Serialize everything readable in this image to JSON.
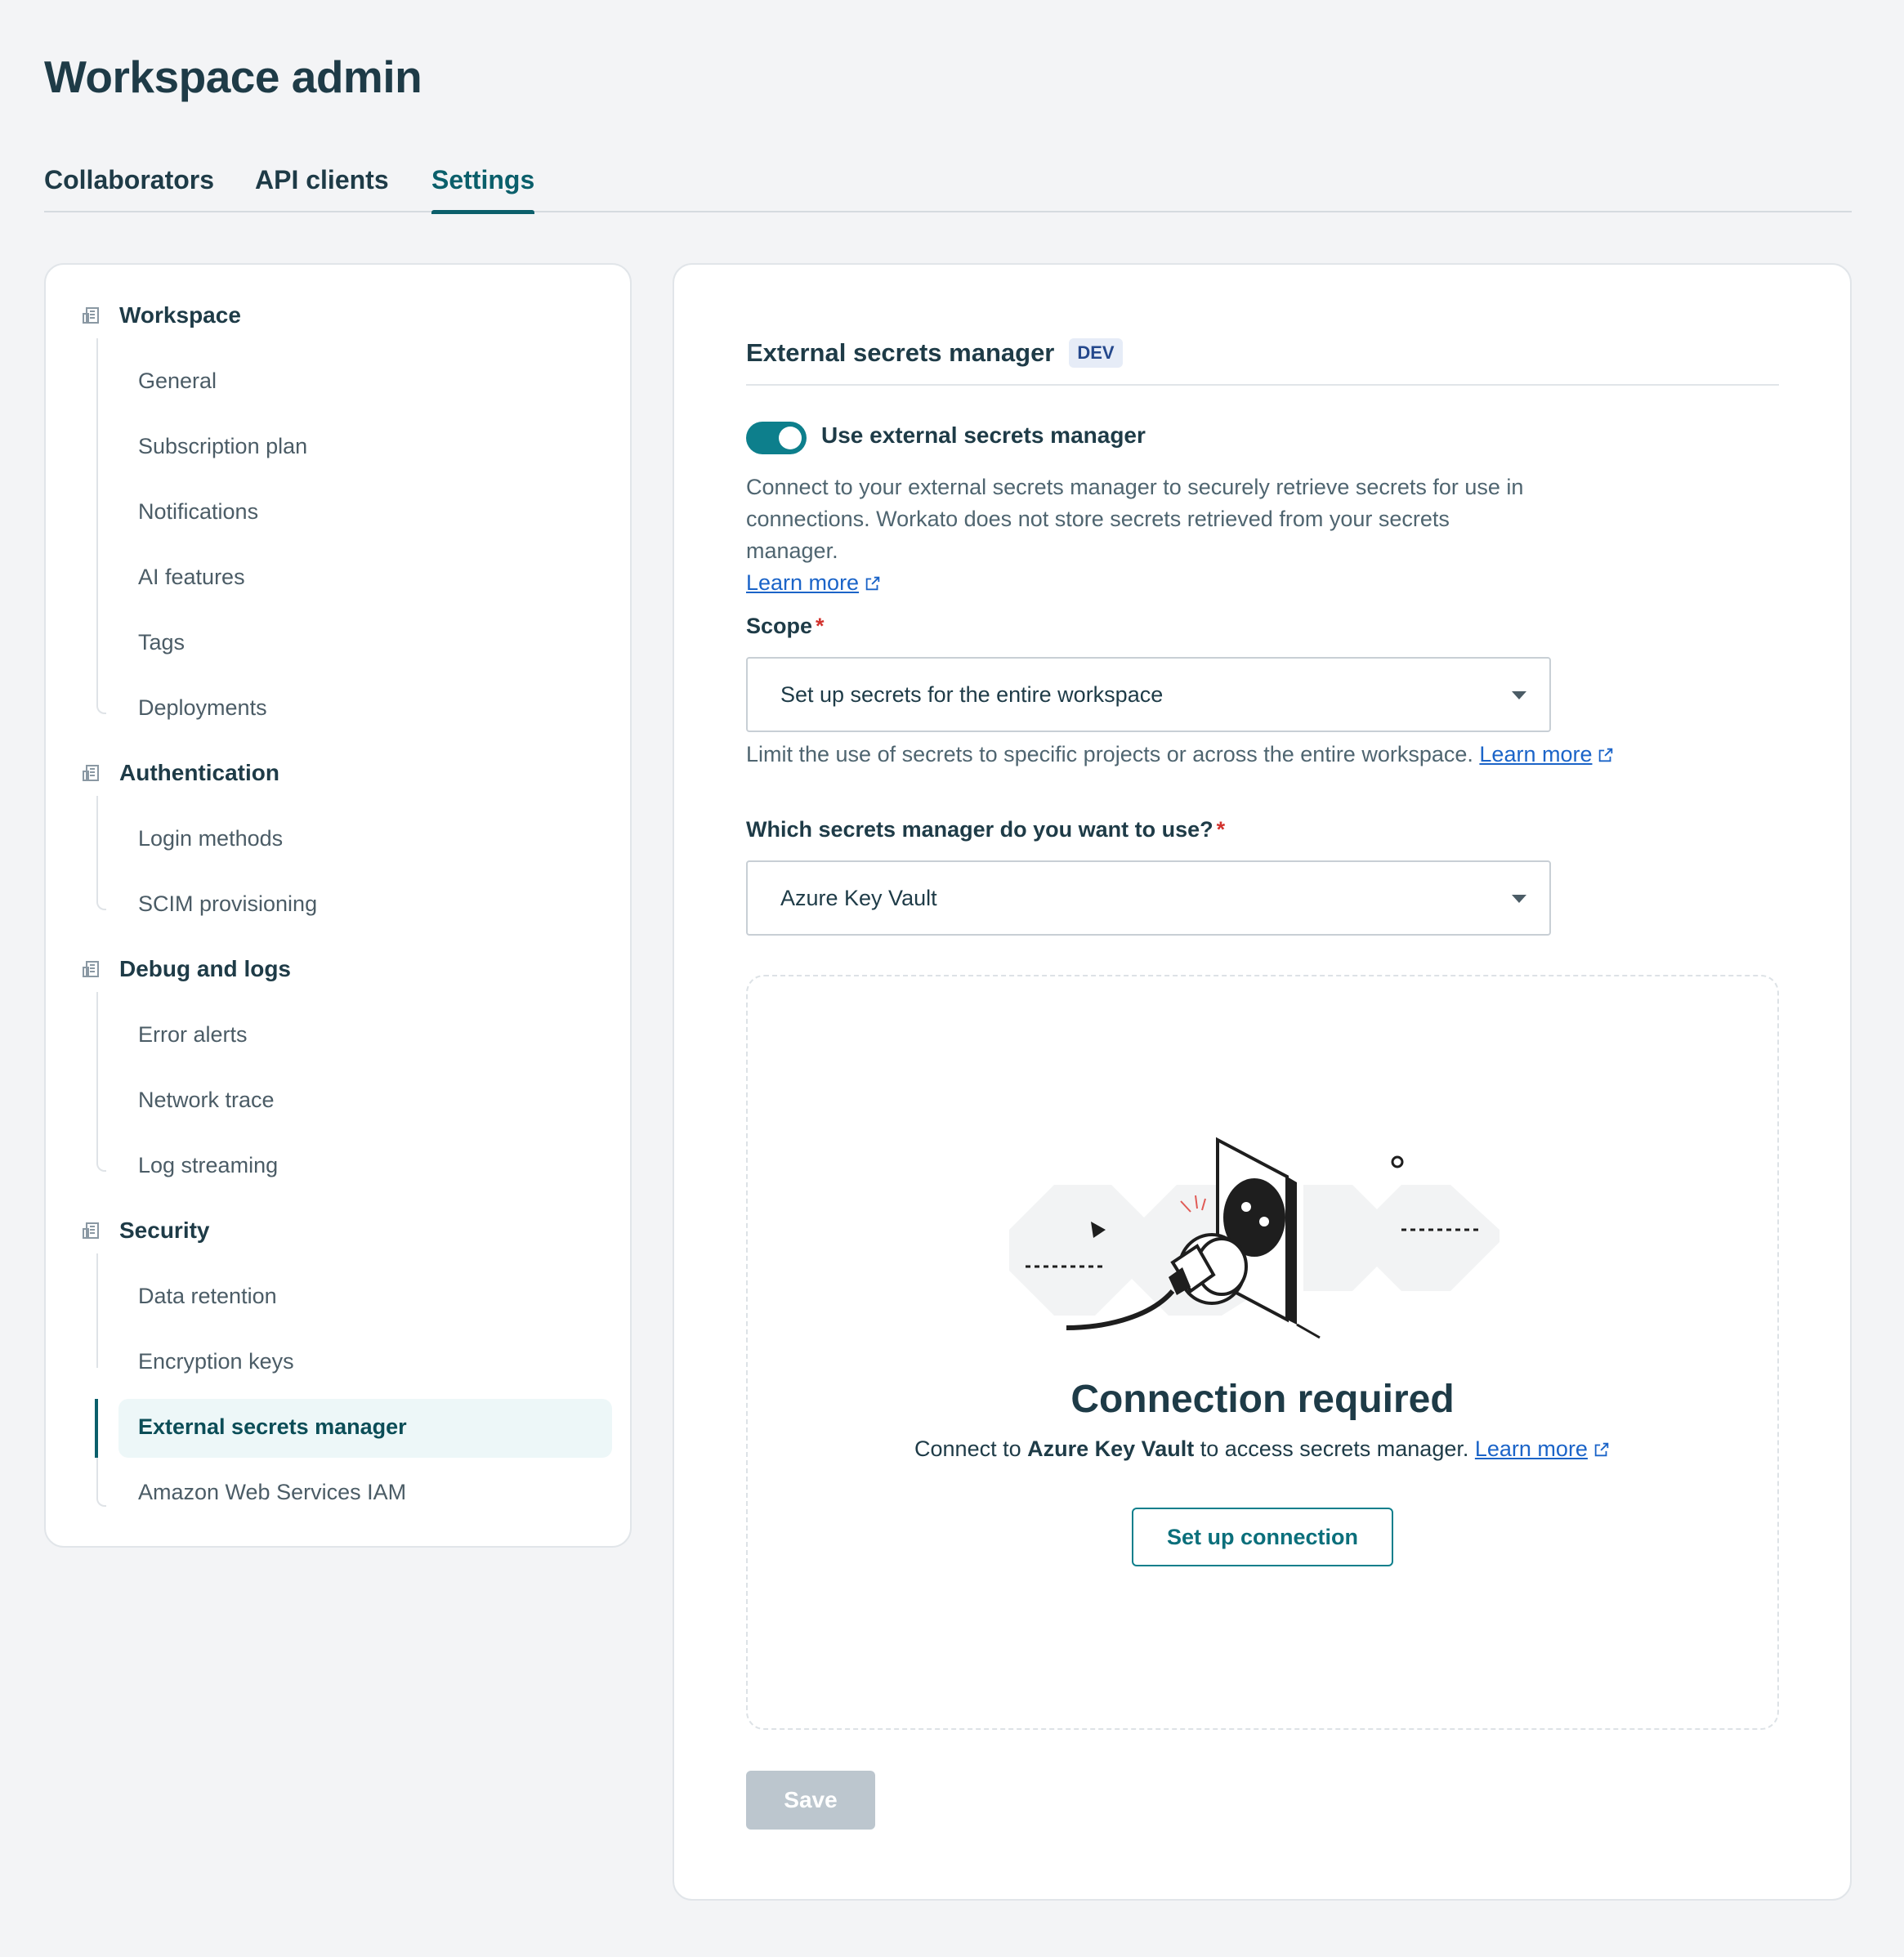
{
  "page": {
    "title": "Workspace admin"
  },
  "tabs": [
    {
      "label": "Collaborators"
    },
    {
      "label": "API clients"
    },
    {
      "label": "Settings",
      "active": true
    }
  ],
  "sidebar": {
    "groups": [
      {
        "label": "Workspace",
        "icon": "building-icon",
        "items": [
          "General",
          "Subscription plan",
          "Notifications",
          "AI features",
          "Tags",
          "Deployments"
        ]
      },
      {
        "label": "Authentication",
        "icon": "building-icon",
        "items": [
          "Login methods",
          "SCIM provisioning"
        ]
      },
      {
        "label": "Debug and logs",
        "icon": "building-icon",
        "items": [
          "Error alerts",
          "Network trace",
          "Log streaming"
        ]
      },
      {
        "label": "Security",
        "icon": "building-icon",
        "items": [
          "Data retention",
          "Encryption keys",
          "External secrets manager",
          "Amazon Web Services IAM"
        ]
      }
    ],
    "active_item": "External secrets manager"
  },
  "main": {
    "section_title": "External secrets manager",
    "badge": "DEV",
    "toggle": {
      "label": "Use external secrets manager",
      "on": true
    },
    "description": "Connect to your external secrets manager to securely retrieve secrets for use in connections. Workato does not store secrets retrieved from your secrets manager.",
    "learn_more": "Learn more",
    "scope": {
      "label": "Scope",
      "required_mark": "*",
      "value": "Set up secrets for the entire workspace",
      "hint": "Limit the use of secrets to specific projects or across the entire workspace."
    },
    "manager": {
      "label": "Which secrets manager do you want to use?",
      "required_mark": "*",
      "value": "Azure Key Vault"
    },
    "empty_state": {
      "title": "Connection required",
      "text_before": "Connect to ",
      "text_bold": "Azure Key Vault",
      "text_after": " to access secrets manager.",
      "button": "Set up connection",
      "illustration": "unplugged-plug-icon"
    },
    "save_label": "Save"
  },
  "colors": {
    "accent": "#0d7f8c",
    "link": "#1b64c8",
    "required": "#d2322d",
    "disabled_button": "#bcc6ce"
  }
}
